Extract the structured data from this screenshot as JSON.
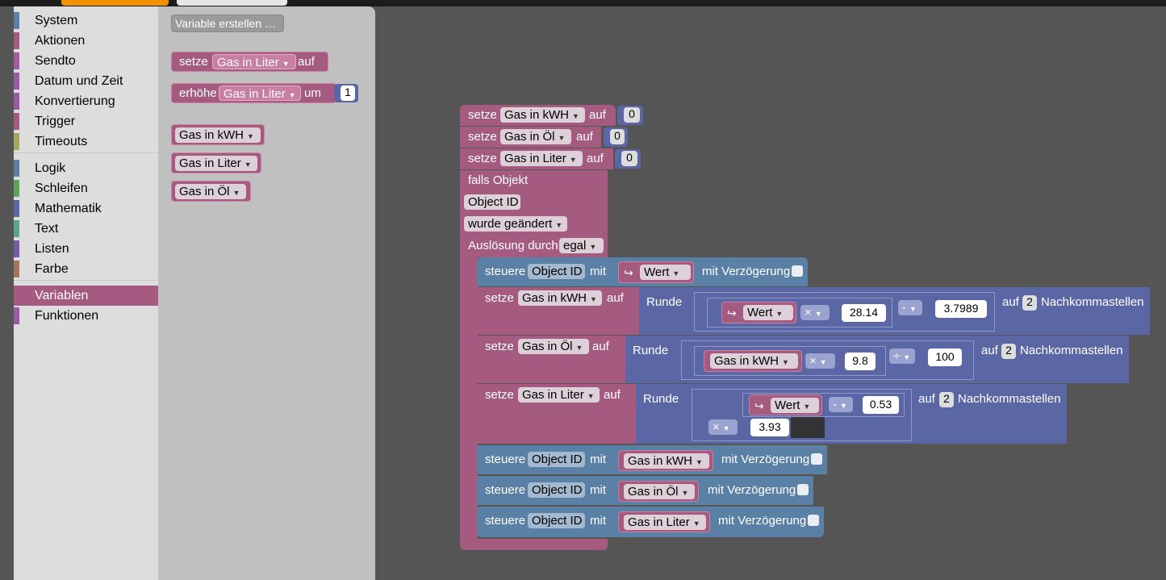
{
  "toolbox": {
    "categories": [
      {
        "label": "System",
        "color": "#5b80a5"
      },
      {
        "label": "Aktionen",
        "color": "#a55b80"
      },
      {
        "label": "Sendto",
        "color": "#a55ba0"
      },
      {
        "label": "Datum und Zeit",
        "color": "#9a5ba5"
      },
      {
        "label": "Konvertierung",
        "color": "#9a5ba5"
      },
      {
        "label": "Trigger",
        "color": "#a55b80"
      },
      {
        "label": "Timeouts",
        "color": "#a5a55b"
      },
      {
        "label": "Logik",
        "color": "#5b80a5"
      },
      {
        "label": "Schleifen",
        "color": "#5ba55b"
      },
      {
        "label": "Mathematik",
        "color": "#5b67a5"
      },
      {
        "label": "Text",
        "color": "#5ba58c"
      },
      {
        "label": "Listen",
        "color": "#745ba5"
      },
      {
        "label": "Farbe",
        "color": "#a5745b"
      },
      {
        "label": "Variablen",
        "color": "#a55b80"
      },
      {
        "label": "Funktionen",
        "color": "#995ba5"
      }
    ]
  },
  "flyout": {
    "create_variable": "Variable erstellen …",
    "set_block": {
      "word": "setze",
      "var": "Gas in Liter",
      "suffix": "auf"
    },
    "change_block": {
      "word": "erhöhe",
      "var": "Gas in Liter",
      "mid": "um",
      "value": "1"
    },
    "getters": [
      "Gas in kWH",
      "Gas in Liter",
      "Gas in Öl"
    ]
  },
  "workspace": {
    "init": [
      {
        "word": "setze",
        "var": "Gas in kWH",
        "suffix": "auf",
        "value": "0"
      },
      {
        "word": "setze",
        "var": "Gas in Öl",
        "suffix": "auf",
        "value": "0"
      },
      {
        "word": "setze",
        "var": "Gas in Liter",
        "suffix": "auf",
        "value": "0"
      }
    ],
    "trigger": {
      "title": "falls Objekt",
      "object": "Object ID",
      "condition": "wurde geändert",
      "cause_label": "Auslösung durch",
      "cause_value": "egal"
    },
    "control1": {
      "word": "steuere",
      "object": "Object ID",
      "mit": "mit",
      "value": "Wert",
      "delay": "mit Verzögerung"
    },
    "calc1": {
      "word": "setze",
      "var": "Gas in kWH",
      "suffix": "auf",
      "round": "Runde",
      "v": "Wert",
      "op1": "×",
      "n1": "28.14",
      "op2": "-",
      "n2": "3.7989",
      "auf": "auf",
      "dec": "2",
      "nk": "Nachkommastellen"
    },
    "calc2": {
      "word": "setze",
      "var": "Gas in Öl",
      "suffix": "auf",
      "round": "Runde",
      "v": "Gas in kWH",
      "op1": "×",
      "n1": "9.8",
      "op2": "÷",
      "n2": "100",
      "auf": "auf",
      "dec": "2",
      "nk": "Nachkommastellen"
    },
    "calc3": {
      "word": "setze",
      "var": "Gas in Liter",
      "suffix": "auf",
      "round": "Runde",
      "v": "Wert",
      "op1": "-",
      "n1": "0.53",
      "op2": "×",
      "n2": "3.93",
      "auf": "auf",
      "dec": "2",
      "nk": "Nachkommastellen"
    },
    "controls": [
      {
        "word": "steuere",
        "object": "Object ID",
        "mit": "mit",
        "value": "Gas in kWH",
        "delay": "mit Verzögerung"
      },
      {
        "word": "steuere",
        "object": "Object ID",
        "mit": "mit",
        "value": "Gas in Öl",
        "delay": "mit Verzögerung"
      },
      {
        "word": "steuere",
        "object": "Object ID",
        "mit": "mit",
        "value": "Gas in Liter",
        "delay": "mit Verzögerung"
      }
    ]
  }
}
